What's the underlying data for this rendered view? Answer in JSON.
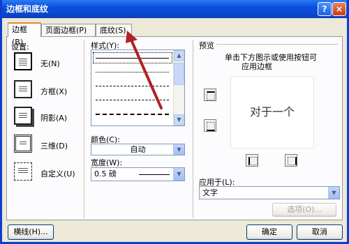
{
  "window": {
    "title": "边框和底纹",
    "help": "?",
    "close": "×"
  },
  "tabs": [
    {
      "label": "边框(B)"
    },
    {
      "label": "页面边框(P)"
    },
    {
      "label": "底纹(S)"
    }
  ],
  "settings": {
    "heading": "设置:",
    "items": [
      {
        "label": "无(N)"
      },
      {
        "label": "方框(X)"
      },
      {
        "label": "阴影(A)"
      },
      {
        "label": "三维(D)"
      },
      {
        "label": "自定义(U)"
      }
    ]
  },
  "style": {
    "label": "样式(Y):"
  },
  "color": {
    "label": "颜色(C):",
    "value": "自动"
  },
  "width": {
    "label": "宽度(W):",
    "value": "0.5 磅"
  },
  "preview": {
    "heading": "预览",
    "hint_line1": "单击下方图示或使用按钮可",
    "hint_line2": "应用边框",
    "sample_text": "对于一个"
  },
  "apply_to": {
    "label": "应用于(L):",
    "value": "文字"
  },
  "buttons": {
    "options": "选项(O)...",
    "horizontal_line": "横线(H)...",
    "ok": "确定",
    "cancel": "取消"
  },
  "colors": {
    "title_bar": "#0a4fdc",
    "tab_highlight": "#e68b2c",
    "annotation_arrow": "#b02025"
  }
}
